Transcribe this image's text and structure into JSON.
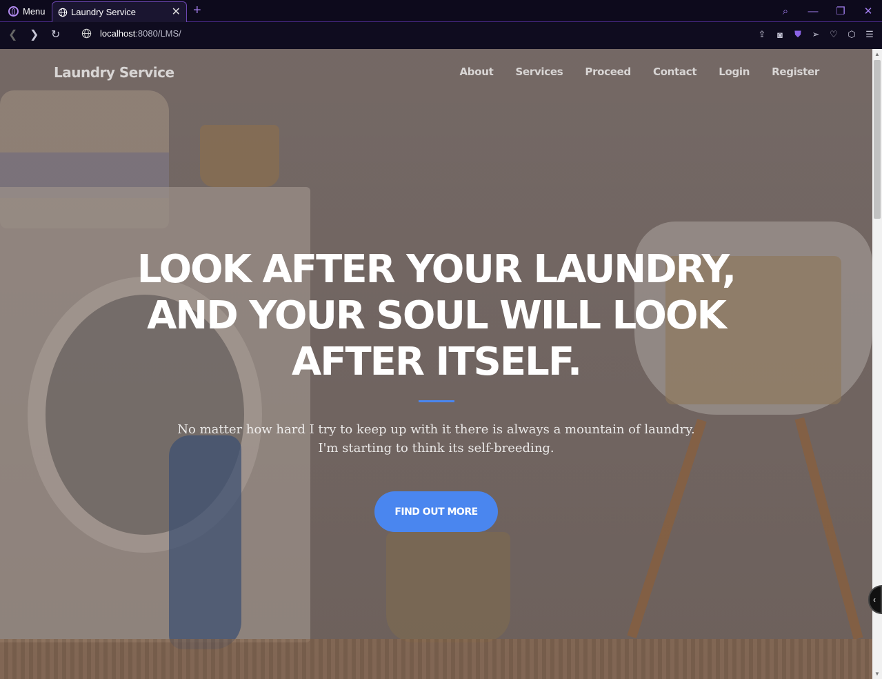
{
  "browser": {
    "menu_label": "Menu",
    "tab_title": "Laundry Service",
    "url_host": "localhost",
    "url_rest": ":8080/LMS/"
  },
  "site": {
    "brand": "Laundry Service",
    "nav": [
      {
        "label": "About"
      },
      {
        "label": "Services"
      },
      {
        "label": "Proceed"
      },
      {
        "label": "Contact"
      },
      {
        "label": "Login"
      },
      {
        "label": "Register"
      }
    ]
  },
  "hero": {
    "title_lines": [
      "LOOK AFTER YOUR LAUNDRY,",
      "AND YOUR SOUL WILL LOOK",
      "AFTER ITSELF."
    ],
    "subtitle_lines": [
      "No matter how hard I try to keep up with it there is always a mountain of laundry.",
      "I'm starting to think its self-breeding."
    ],
    "cta_label": "FIND OUT MORE"
  },
  "colors": {
    "accent": "#4a86ef",
    "chrome_accent": "#8b63e6"
  }
}
